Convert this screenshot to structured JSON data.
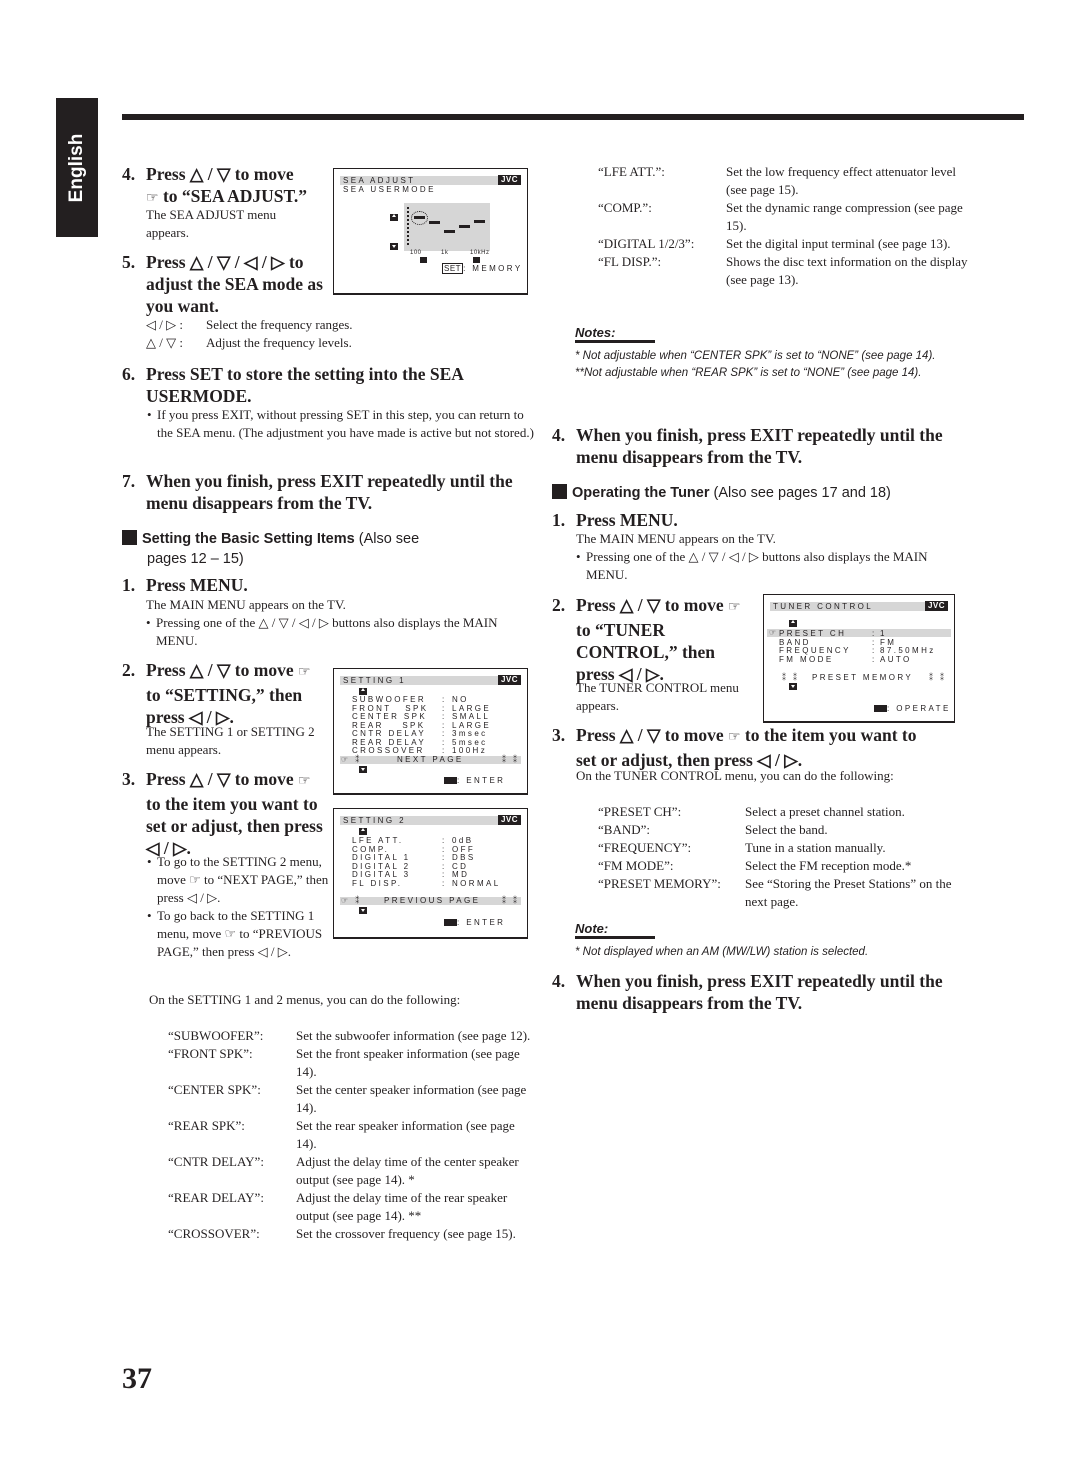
{
  "side_tab": "English",
  "page_number": "37",
  "left": {
    "step4": {
      "num": "4.",
      "line1": "Press △ / ▽ to move",
      "line2": "to “SEA ADJUST.”",
      "desc1": "The SEA ADJUST menu",
      "desc2": "appears."
    },
    "step5": {
      "num": "5.",
      "line1": "Press △ / ▽ / ◁ / ▷ to",
      "line2": "adjust the SEA mode as",
      "line3": "you want.",
      "items": [
        {
          "k": "◁ / ▷ :",
          "v": "Select the frequency ranges."
        },
        {
          "k": "△ / ▽ :",
          "v": "Adjust the frequency levels."
        }
      ]
    },
    "step6": {
      "num": "6.",
      "line1": "Press SET to store the setting into the SEA",
      "line2": "USERMODE.",
      "bullet": "If you press EXIT, without pressing SET in this step, you can return to the SEA menu. (The adjustment you have made is active but not stored.)"
    },
    "step7": {
      "num": "7.",
      "line1": "When you finish, press EXIT repeatedly until the",
      "line2": "menu disappears from the TV."
    },
    "section": {
      "bold": "Setting the Basic Setting Items",
      "rest": " (Also see",
      "line2": "pages 12 – 15)"
    },
    "s1": {
      "num": "1.",
      "title": "Press MENU.",
      "desc": "The MAIN MENU appears on the TV.",
      "bullet": "Pressing one of the △ / ▽ / ◁ / ▷ buttons also displays the MAIN MENU."
    },
    "s2": {
      "num": "2.",
      "line1": "Press △ / ▽ to move",
      "line2": "to “SETTING,” then",
      "line3": "press ◁ / ▷.",
      "desc": "The SETTING 1 or SETTING 2 menu appears."
    },
    "s3": {
      "num": "3.",
      "line1": "Press △ / ▽ to move",
      "line2": "to the item you want to",
      "line3": "set or adjust, then press",
      "line4": "◁ / ▷.",
      "bullets": [
        "To go to the SETTING 2 menu, move ☞ to “NEXT PAGE,” then press ◁ / ▷.",
        "To go back to the SETTING 1 menu, move ☞ to “PREVIOUS PAGE,” then press ◁ / ▷."
      ]
    },
    "intro": "On the SETTING 1 and 2 menus, you can do the following:",
    "defs": [
      {
        "k": "“SUBWOOFER”:",
        "v": "Set the subwoofer information (see page 12)."
      },
      {
        "k": "“FRONT SPK”:",
        "v": "Set the front speaker information (see page 14)."
      },
      {
        "k": "“CENTER SPK”:",
        "v": "Set the center speaker information (see page 14)."
      },
      {
        "k": "“REAR SPK”:",
        "v": "Set the rear speaker information (see page 14)."
      },
      {
        "k": "“CNTR DELAY”:",
        "v": "Adjust the delay time of the center speaker output (see page 14). *"
      },
      {
        "k": "“REAR DELAY”:",
        "v": "Adjust the delay time of the rear speaker output (see page 14). **"
      },
      {
        "k": "“CROSSOVER”:",
        "v": "Set the crossover frequency (see page 15)."
      }
    ]
  },
  "right": {
    "defs": [
      {
        "k": "“LFE ATT.”:",
        "v": "Set the low frequency effect attenuator level (see page 15)."
      },
      {
        "k": "“COMP.”:",
        "v": "Set the dynamic range compression (see page 15)."
      },
      {
        "k": "“DIGITAL 1/2/3”:",
        "v": "Set the digital input terminal (see page 13)."
      },
      {
        "k": "“FL DISP.”:",
        "v": "Shows the disc text information on the display (see page 13)."
      }
    ],
    "notes_title": "Notes:",
    "notes": [
      "*  Not adjustable when “CENTER SPK” is set to “NONE” (see page 14).",
      "**Not adjustable when “REAR SPK” is set to “NONE” (see page 14)."
    ],
    "step4": {
      "num": "4.",
      "line1": "When you finish, press EXIT repeatedly until the",
      "line2": "menu disappears from the TV."
    },
    "section": {
      "bold": "Operating the Tuner",
      "rest": " (Also see pages 17 and 18)"
    },
    "t1": {
      "num": "1.",
      "title": "Press MENU.",
      "desc": "The MAIN MENU appears on the TV.",
      "bullet": "Pressing one of the △ / ▽ / ◁ / ▷ buttons also displays the MAIN MENU."
    },
    "t2": {
      "num": "2.",
      "line1": "Press △ / ▽ to move",
      "line2": "to “TUNER",
      "line3": "CONTROL,” then",
      "line4": "press ◁ / ▷.",
      "desc1": "The TUNER CONTROL menu",
      "desc2": "appears."
    },
    "t3": {
      "num": "3.",
      "line1": "Press △ / ▽ to move",
      "line1b": "to the item you want to",
      "line2": "set or adjust, then press ◁ / ▷.",
      "desc": "On the TUNER CONTROL menu, you can do the following:"
    },
    "tdefs": [
      {
        "k": "“PRESET CH”:",
        "v": "Select a preset channel station."
      },
      {
        "k": "“BAND”:",
        "v": "Select the band."
      },
      {
        "k": "“FREQUENCY”:",
        "v": "Tune in a station manually."
      },
      {
        "k": "“FM MODE”:",
        "v": "Select the FM reception mode.*"
      },
      {
        "k": "“PRESET MEMORY”:",
        "v": "See “Storing the Preset Stations” on the next page."
      }
    ],
    "note_title": "Note:",
    "note": "*  Not displayed when an AM (MW/LW) station is selected.",
    "t4": {
      "num": "4.",
      "line1": "When you finish, press EXIT repeatedly until the",
      "line2": "menu disappears from the TV."
    }
  },
  "osd": {
    "brand": "JVC",
    "pointer": "☞",
    "sea": {
      "title": "SEA ADJUST",
      "sub": "SEA USERMODE",
      "freq_labels": [
        "100",
        "1k",
        "10kHz"
      ],
      "set_key": "SET",
      "memory": ": MEMORY",
      "eq_levels": [
        0.75,
        0.62,
        0.35,
        0.5,
        0.65
      ]
    },
    "setting1": {
      "title": "SETTING 1",
      "rows": [
        {
          "k": "SUBWOOFER",
          "v": "NO"
        },
        {
          "k": "FRONT   SPK",
          "v": "LARGE"
        },
        {
          "k": "CENTER SPK",
          "v": "SMALL"
        },
        {
          "k": "REAR    SPK",
          "v": "LARGE"
        },
        {
          "k": "CNTR DELAY",
          "v": "3msec"
        },
        {
          "k": "REAR DELAY",
          "v": "5msec"
        },
        {
          "k": "CROSSOVER",
          "v": "100Hz"
        }
      ],
      "page_link": "NEXT PAGE",
      "enter": ": ENTER"
    },
    "setting2": {
      "title": "SETTING 2",
      "rows": [
        {
          "k": "LFE ATT.",
          "v": "0dB"
        },
        {
          "k": "COMP.",
          "v": "OFF"
        },
        {
          "k": "DIGITAL 1",
          "v": "DBS"
        },
        {
          "k": "DIGITAL 2",
          "v": "CD"
        },
        {
          "k": "DIGITAL 3",
          "v": "MD"
        },
        {
          "k": "FL DISP.",
          "v": "NORMAL"
        }
      ],
      "page_link": "PREVIOUS PAGE",
      "enter": ": ENTER"
    },
    "tuner": {
      "title": "TUNER CONTROL",
      "rows": [
        {
          "k": "PRESET CH",
          "v": "1"
        },
        {
          "k": "BAND",
          "v": "FM"
        },
        {
          "k": "FREQUENCY",
          "v": "87.50MHz"
        },
        {
          "k": "FM MODE",
          "v": "AUTO"
        }
      ],
      "memory": "PRESET MEMORY",
      "operate": ": OPERATE"
    }
  }
}
